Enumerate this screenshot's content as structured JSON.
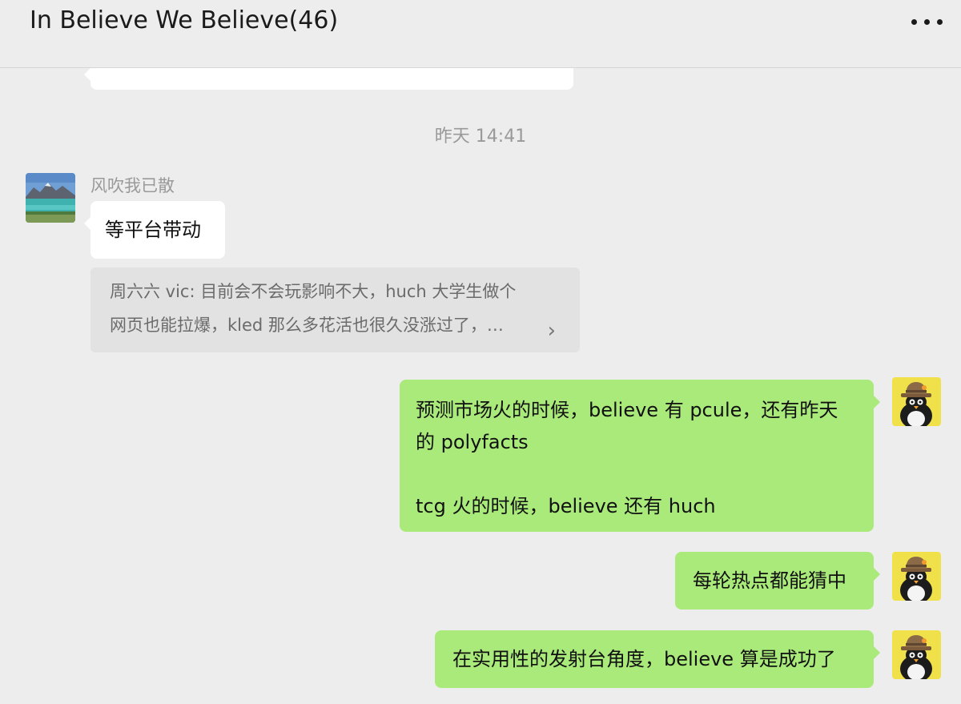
{
  "header": {
    "title": "In Believe We Believe(46)"
  },
  "timestamp": "昨天 14:41",
  "sender_name": "风吹我已散",
  "messages": {
    "incoming_1": "等平台带动",
    "quote_line_1": "周六六 vic: 目前会不会玩影响不大，huch 大学生做个",
    "quote_line_2": "网页也能拉爆，kled 那么多花活也很久没涨过了，…",
    "out_1_line_1": "预测市场火的时候，believe 有 pcule，还有昨天",
    "out_1_line_2": "的 polyfacts",
    "out_1_line_3": "tcg 火的时候，believe 还有 huch",
    "out_2": "每轮热点都能猜中",
    "out_3": "在实用性的发射台角度，believe 算是成功了"
  },
  "icons": {
    "more": "more-dots-icon",
    "quote_arrow": "chevron-right-icon",
    "avatar_left": "landscape-lake-avatar",
    "avatar_right": "penguin-avatar"
  },
  "colors": {
    "background": "#ededed",
    "outgoing_bubble": "#a9ea7a",
    "incoming_bubble": "#ffffff",
    "quote_bg": "#e2e2e2"
  }
}
